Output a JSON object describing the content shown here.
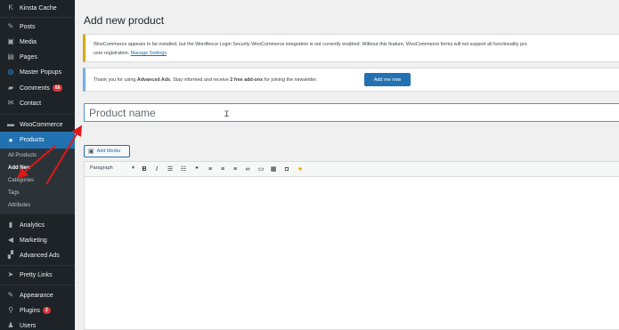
{
  "sidebar": {
    "items": [
      {
        "key": "kinsta",
        "icon": "kinsta-icon",
        "glyph": "K",
        "label": "Kinsta Cache"
      },
      {
        "key": "posts",
        "icon": "pushpin-icon",
        "glyph": "📌",
        "label": "Posts"
      },
      {
        "key": "media",
        "icon": "media-icon",
        "glyph": "▣",
        "label": "Media"
      },
      {
        "key": "pages",
        "icon": "pages-icon",
        "glyph": "▤",
        "label": "Pages"
      },
      {
        "key": "master-popups",
        "icon": "popups-icon",
        "glyph": "◎",
        "label": "Master Popups"
      },
      {
        "key": "comments",
        "icon": "comments-icon",
        "glyph": "▰",
        "label": "Comments",
        "badge": "66"
      },
      {
        "key": "contact",
        "icon": "mail-icon",
        "glyph": "✉",
        "label": "Contact"
      },
      {
        "key": "woocommerce",
        "icon": "woo-icon",
        "glyph": "▬",
        "label": "WooCommerce"
      },
      {
        "key": "products",
        "icon": "products-icon",
        "glyph": "●",
        "label": "Products"
      },
      {
        "key": "analytics",
        "icon": "analytics-icon",
        "glyph": "▮",
        "label": "Analytics"
      },
      {
        "key": "marketing",
        "icon": "megaphone-icon",
        "glyph": "◀",
        "label": "Marketing"
      },
      {
        "key": "advanced-ads",
        "icon": "ads-icon",
        "glyph": "▞",
        "label": "Advanced Ads"
      },
      {
        "key": "pretty-links",
        "icon": "links-icon",
        "glyph": "➤",
        "label": "Pretty Links"
      },
      {
        "key": "appearance",
        "icon": "brush-icon",
        "glyph": "✎",
        "label": "Appearance"
      },
      {
        "key": "plugins",
        "icon": "plug-icon",
        "glyph": "⚲",
        "label": "Plugins",
        "badge": "2"
      },
      {
        "key": "users",
        "icon": "user-icon",
        "glyph": "♟",
        "label": "Users"
      }
    ],
    "submenu": [
      "All Products",
      "Add New",
      "Categories",
      "Tags",
      "Attributes"
    ]
  },
  "main": {
    "page_title": "Add new product",
    "notice_wordfence": {
      "line1": "WooCommerce appears to be installed, but the Wordfence Login Security WooCommerce integration is not currently enabled. Without this feature, WooCommerce forms will not support all functionality pro",
      "line2_prefix": "user registration.",
      "line2_link": "Manage Settings"
    },
    "notice_ads": {
      "text_prefix": "Thank you for using",
      "brand": "Advanced Ads",
      "text_middle": ". Stay informed and receive",
      "bold": "2 free add-ons",
      "text_suffix": "for joining the newsletter.",
      "button": "Add me now"
    },
    "title_placeholder": "Product name",
    "add_media": "Add Media",
    "toolbar": {
      "format": "Paragraph",
      "buttons": [
        {
          "name": "bold-icon",
          "glyph": "B"
        },
        {
          "name": "italic-icon",
          "glyph": "I"
        },
        {
          "name": "bullet-list-icon",
          "glyph": "☰"
        },
        {
          "name": "numbered-list-icon",
          "glyph": "☷"
        },
        {
          "name": "blockquote-icon",
          "glyph": "❝"
        },
        {
          "name": "align-left-icon",
          "glyph": "≡"
        },
        {
          "name": "align-center-icon",
          "glyph": "≡"
        },
        {
          "name": "align-right-icon",
          "glyph": "≡"
        },
        {
          "name": "link-icon",
          "glyph": "∞"
        },
        {
          "name": "insert-more-icon",
          "glyph": "▭"
        },
        {
          "name": "toolbar-toggle-icon",
          "glyph": "▦"
        },
        {
          "name": "square-icon",
          "glyph": "◘"
        },
        {
          "name": "star-icon",
          "glyph": "★",
          "color": "#f0a500"
        }
      ]
    }
  },
  "colors": {
    "sidebar_bg": "#1d2327",
    "active_blue": "#2271b1",
    "badge_red": "#d63638",
    "annotation_red": "#e01818",
    "notice_warning": "#dba617"
  }
}
